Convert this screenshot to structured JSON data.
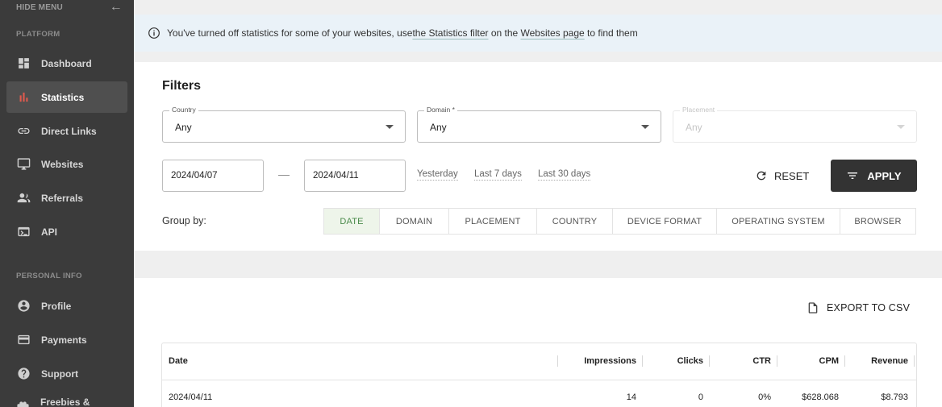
{
  "sidebar": {
    "hide_menu": "HIDE MENU",
    "platform_label": "PLATFORM",
    "items": [
      {
        "label": "Dashboard",
        "icon": "dashboard-icon"
      },
      {
        "label": "Statistics",
        "icon": "bar-chart-icon",
        "active": true
      },
      {
        "label": "Direct Links",
        "icon": "link-icon"
      },
      {
        "label": "Websites",
        "icon": "monitor-icon"
      },
      {
        "label": "Referrals",
        "icon": "people-icon"
      },
      {
        "label": "API",
        "icon": "terminal-icon"
      }
    ],
    "personal_label": "PERSONAL INFO",
    "personal_items": [
      {
        "label": "Profile",
        "icon": "account-circle-icon"
      },
      {
        "label": "Payments",
        "icon": "credit-card-icon"
      },
      {
        "label": "Support",
        "icon": "help-icon"
      },
      {
        "label": "Freebies & bonuses",
        "icon": "gift-icon"
      }
    ]
  },
  "banner": {
    "text_before": "You've turned off statistics for some of your websites, use ",
    "link1": "the Statistics filter",
    "text_mid": " on the ",
    "link2": "Websites page",
    "text_after": " to find them"
  },
  "filters": {
    "title": "Filters",
    "country": {
      "label": "Country",
      "value": "Any"
    },
    "domain": {
      "label": "Domain *",
      "value": "Any"
    },
    "placement": {
      "label": "Placement",
      "value": "Any"
    },
    "date_from": "2024/04/07",
    "date_sep": "—",
    "date_to": "2024/04/11",
    "quick": [
      "Yesterday",
      "Last 7 days",
      "Last 30 days"
    ],
    "reset_label": "RESET",
    "apply_label": "APPLY",
    "group_by_label": "Group by:",
    "group_by": [
      "DATE",
      "DOMAIN",
      "PLACEMENT",
      "COUNTRY",
      "DEVICE FORMAT",
      "OPERATING SYSTEM",
      "BROWSER"
    ]
  },
  "results": {
    "export_label": "EXPORT TO CSV",
    "columns": [
      "Date",
      "Impressions",
      "Clicks",
      "CTR",
      "CPM",
      "Revenue"
    ],
    "rows": [
      [
        "2024/04/11",
        "14",
        "0",
        "0%",
        "$628.068",
        "$8.793"
      ]
    ]
  },
  "colors": {
    "sidebar_bg": "#3b3b3b",
    "active_icon": "#e05a4e",
    "apply_bg": "#333333",
    "banner_bg": "#eaf2f8",
    "group_active": "#eef5ea"
  }
}
